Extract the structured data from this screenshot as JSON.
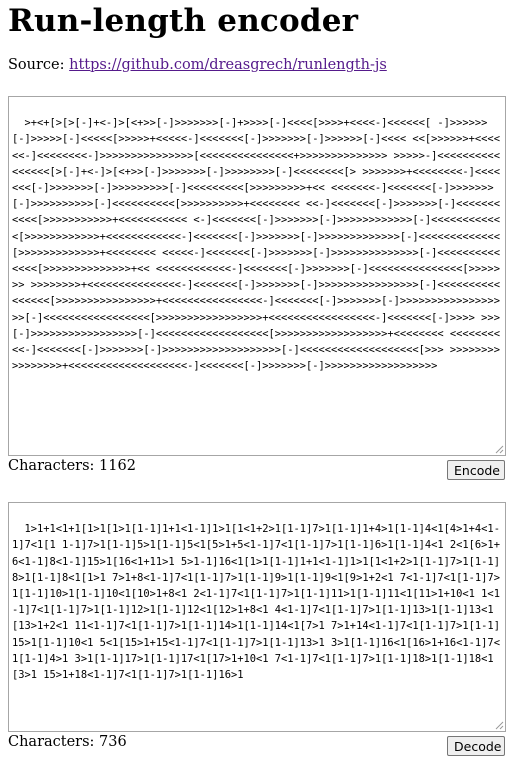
{
  "page": {
    "title": "Run-length encoder",
    "source_label": "Source: ",
    "source_link": "https://github.com/dreasgrech/runlength-js"
  },
  "input": {
    "text": ">+<+[>[>[-]+<-]>[<+>>[-]>>>>>>>[-]+>>>>[-]<<<<[>>>>+<<<<-]<<<<<<[ -]>>>>>>[-]>>>>>[-]<<<<<[>>>>>+<<<<<-]<<<<<<<[-]>>>>>>>[-]>>>>>>[-]<<<< <<[>>>>>>+<<<<<<-]<<<<<<<<-]>>>>>>>>>>>>>>>[<<<<<<<<<<<<<<<+>>>>>>>>>>>>>> >>>>>-]<<<<<<<<<<<<<<<<[>[-]+<-]>[<+>>[-]>>>>>>>[-]>>>>>>>>[-]<<<<<<<<[> >>>>>>>+<<<<<<<<-]<<<<<<<[-]>>>>>>>[-]>>>>>>>>>[-]<<<<<<<<<[>>>>>>>>>+<< <<<<<<<-]<<<<<<<[-]>>>>>>>[-]>>>>>>>>>>[-]<<<<<<<<<<[>>>>>>>>>>+<<<<<<<< <<-]<<<<<<<[-]>>>>>>>[-]<<<<<<<<<<<[>>>>>>>>>>>+<<<<<<<<<<< <-]<<<<<<<[-]>>>>>>>[-]>>>>>>>>>>>>[-]<<<<<<<<<<<<[>>>>>>>>>>>>+<<<<<<<<<<<<-]<<<<<<<[-]>>>>>>>[-]>>>>>>>>>>>>>[-]<<<<<<<<<<<<<[>>>>>>>>>>>>>+<<<<<<<< <<<<<-]<<<<<<<[-]>>>>>>>[-]>>>>>>>>>>>>>>[-]<<<<<<<<<<<<<<[>>>>>>>>>>>>>>+<< <<<<<<<<<<<<-]<<<<<<<[-]>>>>>>>[-]<<<<<<<<<<<<<<<[>>>>>>> >>>>>>>>+<<<<<<<<<<<<<<<-]<<<<<<<[-]>>>>>>>[-]>>>>>>>>>>>>>>>>[-]<<<<<<<<<< <<<<<<[>>>>>>>>>>>>>>>>+<<<<<<<<<<<<<<<<-]<<<<<<<[-]>>>>>>>[-]>>>>>>>>>>>>>>>> >>[-]<<<<<<<<<<<<<<<<<[>>>>>>>>>>>>>>>>>+<<<<<<<<<<<<<<<<<-]<<<<<<<[-]>>>> >>>[-]>>>>>>>>>>>>>>>>>[-]<<<<<<<<<<<<<<<<<<[>>>>>>>>>>>>>>>>>>+<<<<<<<< <<<<<<<<<<-]<<<<<<<[-]>>>>>>>[-]>>>>>>>>>>>>>>>>>>>[-]<<<<<<<<<<<<<<<<<<<[>>> >>>>>>>>>>>>>>>>+<<<<<<<<<<<<<<<<<<<-]<<<<<<<[-]>>>>>>>[-]>>>>>>>>>>>>>>>>>>",
    "count_label": "Characters: 1162"
  },
  "output": {
    "text": "1>1+1<1+1[1>1[1>1[1-1]1+1<1-1]1>1[1<1+2>1[1-1]7>1[1-1]1+4>1[1-1]4<1[4>1+4<1-1]7<1[1 1-1]7>1[1-1]5>1[1-1]5<1[5>1+5<1-1]7<1[1-1]7>1[1-1]6>1[1-1]4<1 2<1[6>1+6<1-1]8<1-1]15>1[16<1+11>1 5>1-1]16<1[1>1[1-1]1+1<1-1]1>1[1<1+2>1[1-1]7>1[1-1]8>1[1-1]8<1[1>1 7>1+8<1-1]7<1[1-1]7>1[1-1]9>1[1-1]9<1[9>1+2<1 7<1-1]7<1[1-1]7>1[1-1]10>1[1-1]10<1[10>1+8<1 2<1-1]7<1[1-1]7>1[1-1]11>1[1-1]11<1[11>1+10<1 1<1-1]7<1[1-1]7>1[1-1]12>1[1-1]12<1[12>1+8<1 4<1-1]7<1[1-1]7>1[1-1]13>1[1-1]13<1[13>1+2<1 11<1-1]7<1[1-1]7>1[1-1]14>1[1-1]14<1[7>1 7>1+14<1-1]7<1[1-1]7>1[1-1]15>1[1-1]10<1 5<1[15>1+15<1-1]7<1[1-1]7>1[1-1]13>1 3>1[1-1]16<1[16>1+16<1-1]7<1[1-1]4>1 3>1[1-1]17>1[1-1]17<1[17>1+10<1 7<1-1]7<1[1-1]7>1[1-1]18>1[1-1]18<1[3>1 15>1+18<1-1]7<1[1-1]7>1[1-1]16>1",
    "count_label": "Characters: 736"
  },
  "buttons": {
    "encode": "Encode",
    "decode": "Decode"
  }
}
